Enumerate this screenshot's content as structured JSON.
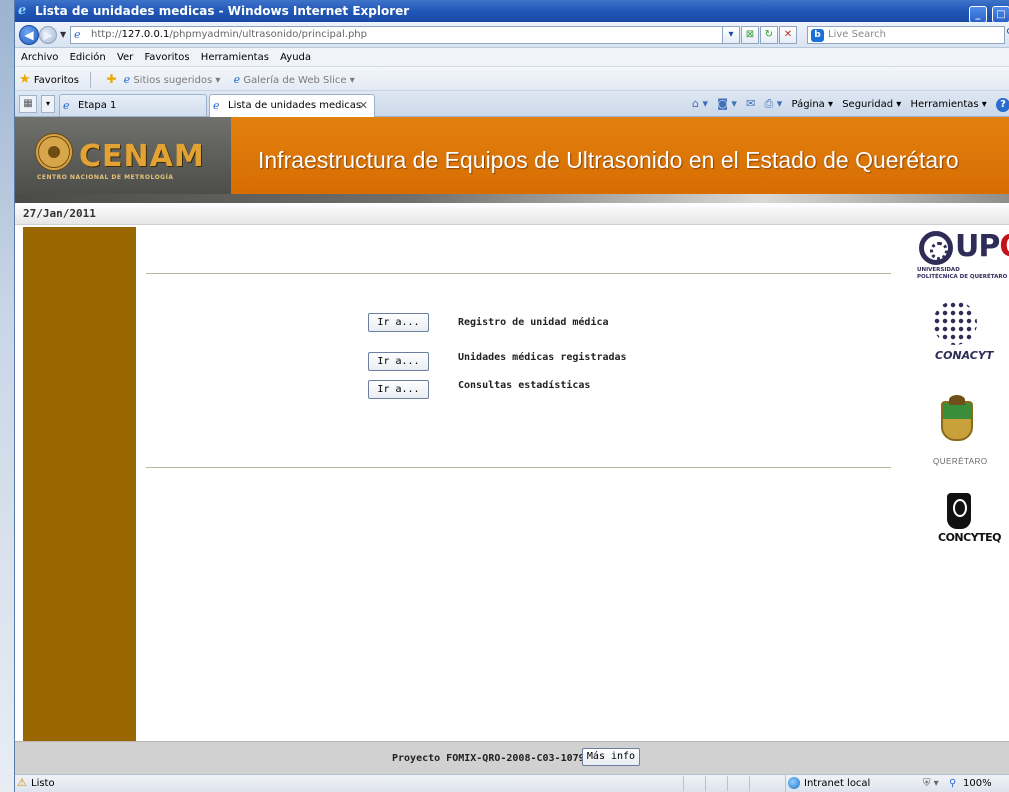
{
  "window": {
    "title": "Lista de unidades medicas - Windows Internet Explorer",
    "controls": [
      "_",
      "□"
    ]
  },
  "address_bar": {
    "url_scheme": "http://",
    "url_host": "127.0.0.1",
    "url_path": "/phpmyadmin/ultrasonido/principal.php",
    "search_placeholder": "Live Search",
    "search_brand": "b"
  },
  "menu": [
    "Archivo",
    "Edición",
    "Ver",
    "Favoritos",
    "Herramientas",
    "Ayuda"
  ],
  "favorites_bar": {
    "favorites_label": "Favoritos",
    "links": [
      {
        "label": "Sitios sugeridos ▾"
      },
      {
        "label": "Galería de Web Slice ▾"
      }
    ]
  },
  "tabs": [
    {
      "label": "Etapa 1",
      "active": false
    },
    {
      "label": "Lista de unidades medicas",
      "active": true
    }
  ],
  "command_bar": {
    "page": "Página ▾",
    "security": "Seguridad ▾",
    "tools": "Herramientas ▾"
  },
  "banner": {
    "logo_text": "CENAM",
    "logo_subtitle": "CENTRO NACIONAL DE METROLOGÍA",
    "title": "Infraestructura de Equipos de Ultrasonido en el Estado de Querétaro"
  },
  "date": "27/Jan/2011",
  "options": [
    {
      "button": "Ir a...",
      "label": "Registro de unidad médica"
    },
    {
      "button": "Ir a...",
      "label": "Unidades médicas registradas"
    },
    {
      "button": "Ir a...",
      "label": "Consultas estadísticas"
    }
  ],
  "logos": {
    "upq": {
      "text_main": "UP",
      "text_q": "Q",
      "sub_line1": "UNIVERSIDAD",
      "sub_line2": "POLITÉCNICA DE QUERÉTARO"
    },
    "conacyt": "CONACYT",
    "queretaro": "QUERÉTARO",
    "concyteq": "CONCYTEQ"
  },
  "footer": {
    "text": "Proyecto FOMIX-QRO-2008-C03-107938",
    "button": "Más info"
  },
  "status_bar": {
    "status": "Listo",
    "zone": "Intranet local",
    "zoom": "100%"
  },
  "colors": {
    "banner_orange": "#d66b00",
    "sidebar_brown": "#996600",
    "footer_gray": "#d1d1d1",
    "title_blue": "#2157b7"
  }
}
